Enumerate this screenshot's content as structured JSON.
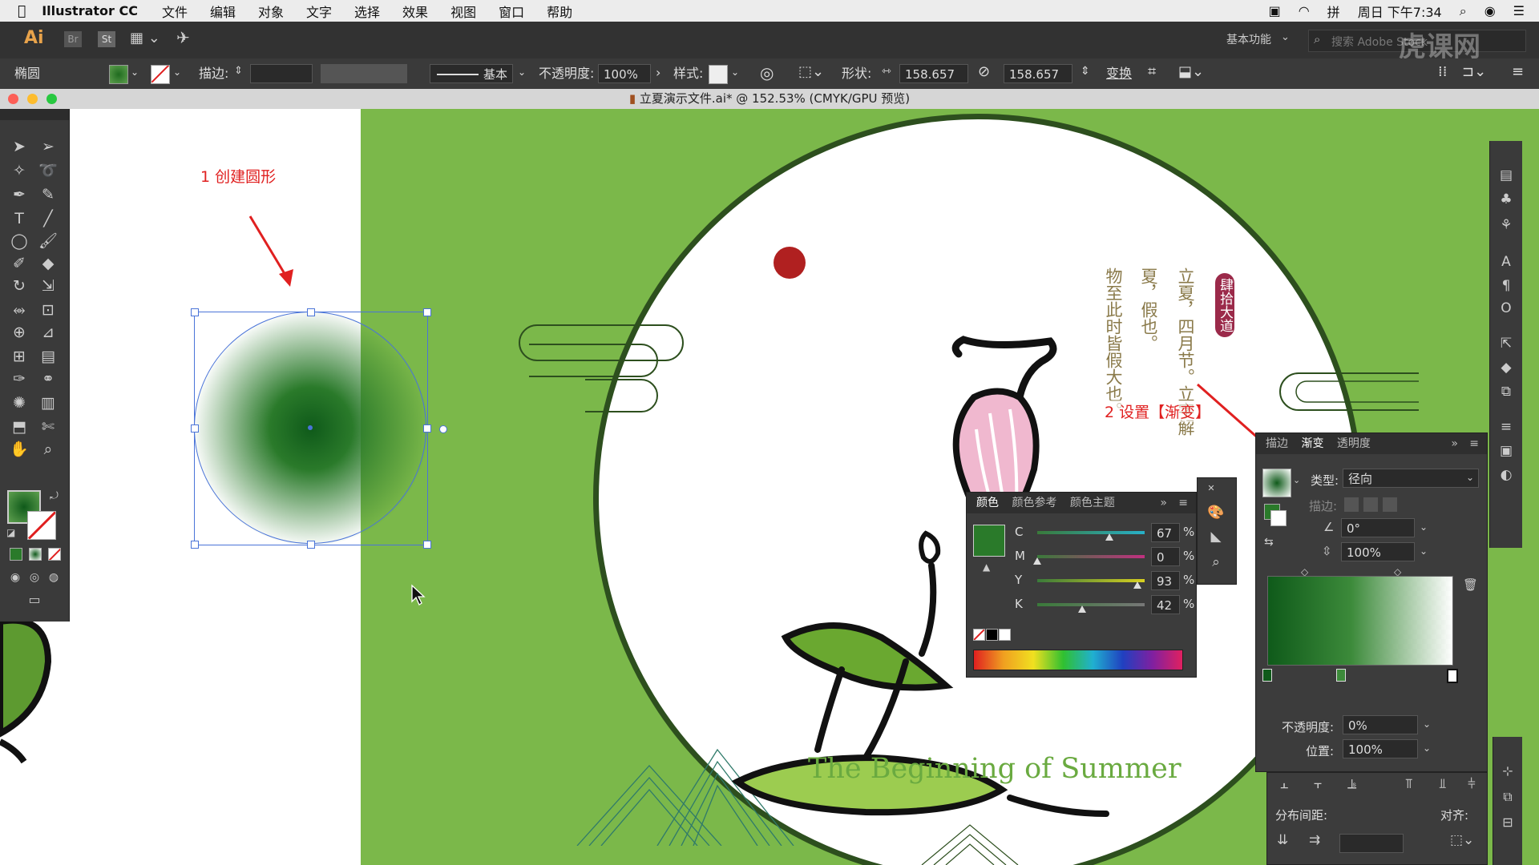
{
  "menubar": {
    "app": "Illustrator CC",
    "items": [
      "文件",
      "编辑",
      "对象",
      "文字",
      "选择",
      "效果",
      "视图",
      "窗口",
      "帮助"
    ],
    "datetime": "周日 下午7:34"
  },
  "appbar": {
    "ai_logo": "Ai",
    "br": "Br",
    "st": "St",
    "workspace": "基本功能",
    "search_placeholder": "搜索 Adobe Stock",
    "watermark": "虎课网"
  },
  "control": {
    "object_type": "椭圆",
    "stroke_label": "描边:",
    "stroke_style": "基本",
    "opacity_label": "不透明度:",
    "opacity_value": "100%",
    "style_label": "样式:",
    "shape_label": "形状:",
    "width_value": "158.657 px",
    "height_value": "158.657 px",
    "transform_label": "变换"
  },
  "document": {
    "title": "立夏演示文件.ai* @ 152.53% (CMYK/GPU 预览)"
  },
  "annotations": {
    "step1": "1 创建圆形",
    "step2": "2 设置【渐变】"
  },
  "artwork": {
    "subtitle": "The Beginning of Summer",
    "vertical_col1": "立夏，四月节。立字解",
    "vertical_col2": "夏，假也。",
    "vertical_col3": "物至此时皆假大也。",
    "seal": "肆拾大道"
  },
  "color_panel": {
    "tabs": [
      "颜色",
      "颜色参考",
      "颜色主题"
    ],
    "channels": [
      {
        "name": "C",
        "value": "67",
        "color": "#28b0c8",
        "pos": 0.67
      },
      {
        "name": "M",
        "value": "0",
        "color": "#c03080",
        "pos": 0.0
      },
      {
        "name": "Y",
        "value": "93",
        "color": "#d8d020",
        "pos": 0.93
      },
      {
        "name": "K",
        "value": "42",
        "color": "#777",
        "pos": 0.42
      }
    ],
    "pct": "%"
  },
  "gradient_panel": {
    "tabs": [
      "描边",
      "渐变",
      "透明度"
    ],
    "type_label": "类型:",
    "type_value": "径向",
    "stroke_label": "描边:",
    "angle_value": "0°",
    "ratio_value": "100%",
    "opacity_label": "不透明度:",
    "opacity_value": "0%",
    "location_label": "位置:",
    "location_value": "100%"
  },
  "align_panel": {
    "distribute_label": "分布间距:",
    "align_to_label": "对齐:"
  },
  "colors": {
    "bg_green": "#7bb84a",
    "dark_green": "#2f7a2a",
    "red_dot": "#b02020",
    "accent_red": "#e02020",
    "seal_red": "#9b2a4a"
  }
}
